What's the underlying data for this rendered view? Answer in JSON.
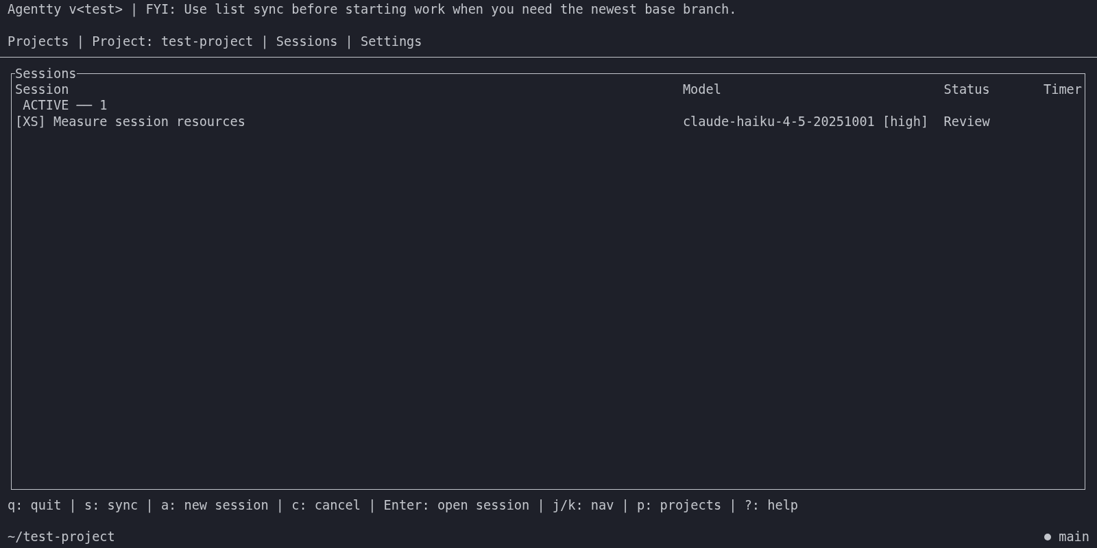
{
  "header": {
    "text": "Agentty v<test> | FYI: Use list sync before starting work when you need the newest base branch."
  },
  "tabs": [
    {
      "label": "Projects",
      "separator": "|"
    },
    {
      "label": "Project: test-project",
      "separator": "|"
    },
    {
      "label": "Sessions",
      "separator": "|"
    },
    {
      "label": "Settings"
    }
  ],
  "sessions_panel": {
    "title": "Sessions",
    "columns": [
      "Session",
      "Model",
      "Status",
      "Timer"
    ],
    "groups": [
      {
        "label": "ACTIVE ── 1",
        "rows": [
          {
            "cells": [
              "[XS] Measure session resources",
              "claude-haiku-4-5-20251001 [high]",
              "Review"
            ]
          }
        ]
      }
    ]
  },
  "key_hints": "q: quit | s: sync | a: new session | c: cancel | Enter: open session | j/k: nav | p: projects | ?: help",
  "status_bar": {
    "path": "~/test-project",
    "branch": "main"
  }
}
